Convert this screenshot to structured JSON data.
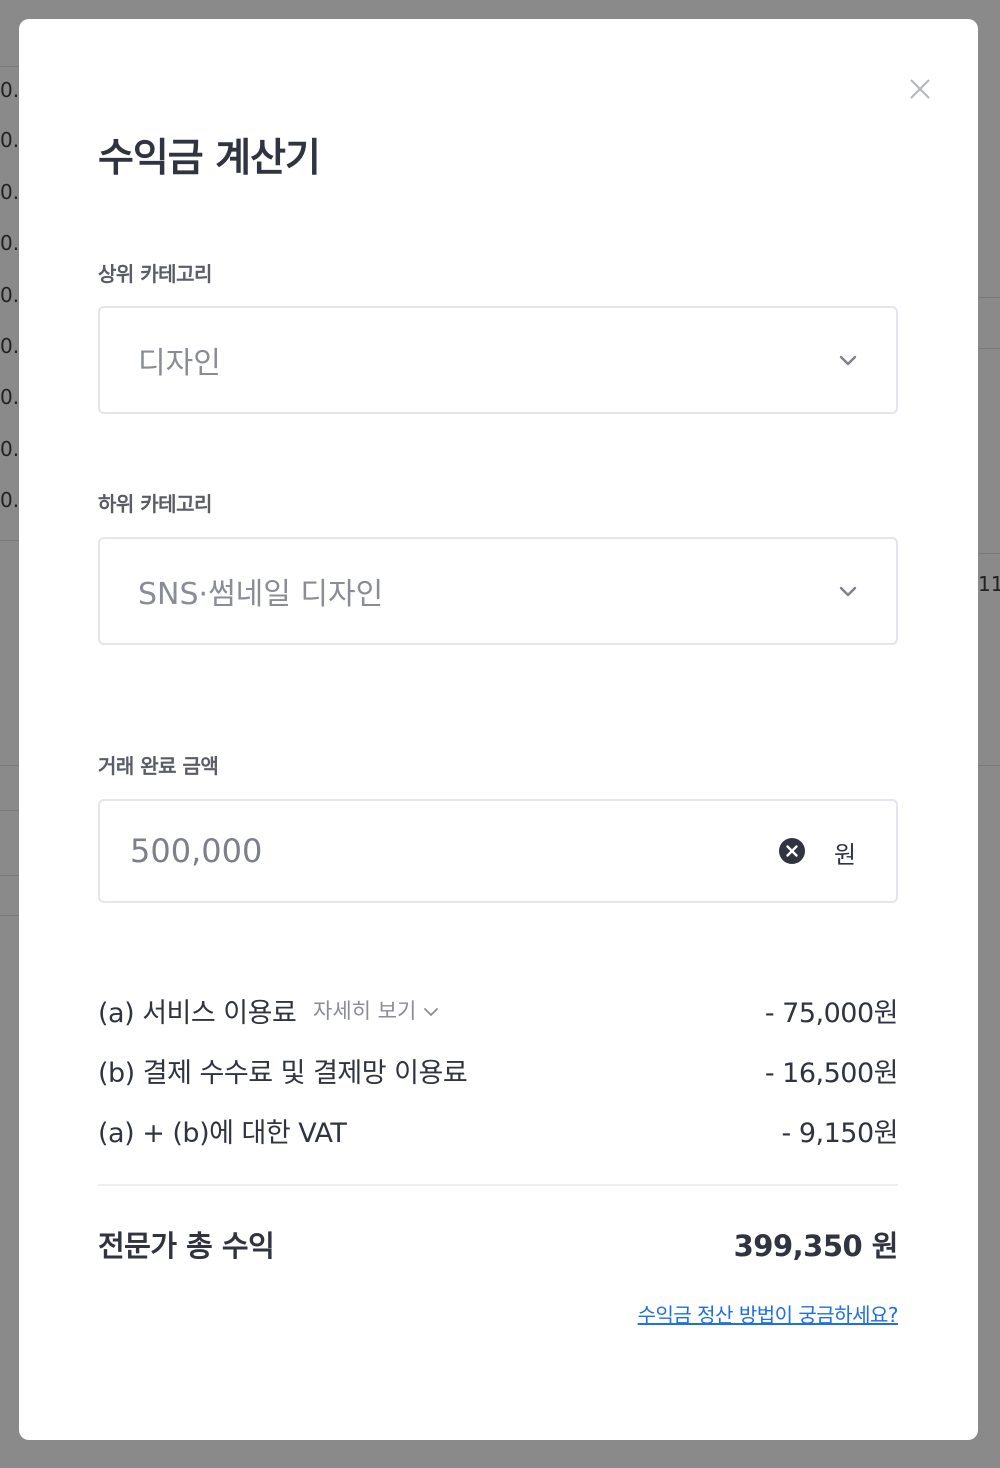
{
  "background": {
    "left_texts": [
      "0.",
      "0.",
      "0.",
      "0.",
      "0.",
      "0.",
      "0.",
      "0.",
      "0."
    ],
    "right_text": "11"
  },
  "modal": {
    "title": "수익금 계산기",
    "close_icon": "close-icon",
    "parent_category": {
      "label": "상위 카테고리",
      "value": "디자인"
    },
    "sub_category": {
      "label": "하위 카테고리",
      "value": "SNS·썸네일 디자인"
    },
    "amount": {
      "label": "거래 완료 금액",
      "value": "500,000",
      "unit": "원"
    },
    "fees": [
      {
        "label": "(a) 서비스 이용료",
        "value": "- 75,000원",
        "detail_link": "자세히 보기"
      },
      {
        "label": "(b) 결제 수수료 및 결제망 이용료",
        "value": "- 16,500원"
      },
      {
        "label": "(a) + (b)에 대한 VAT",
        "value": "- 9,150원"
      }
    ],
    "total": {
      "label": "전문가 총 수익",
      "value": "399,350 원"
    },
    "help_link": "수익금 정산 방법이 궁금하세요?"
  },
  "colors": {
    "overlay": "#8a8a8a",
    "modal_bg": "#ffffff",
    "text_primary": "#303441",
    "text_muted": "#8a8d96",
    "border": "#e4e5ed",
    "link": "#1f6fe5"
  }
}
